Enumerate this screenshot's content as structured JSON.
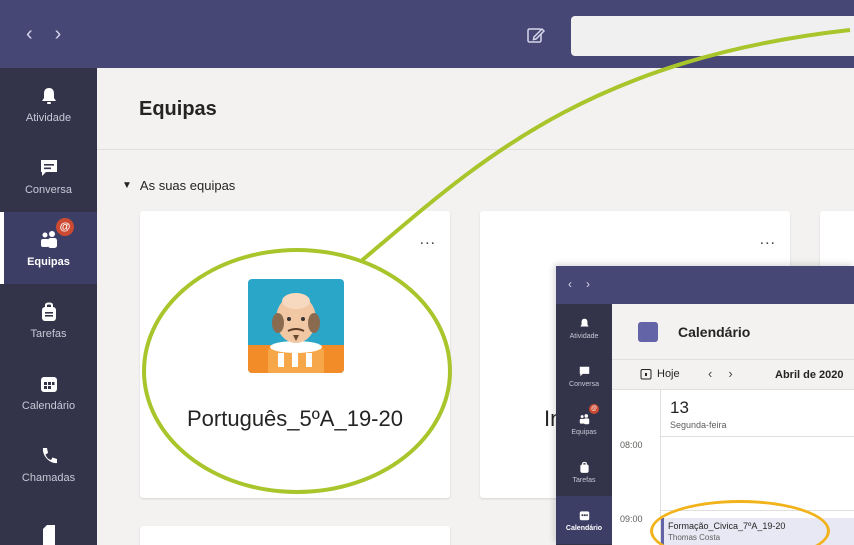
{
  "topbar": {
    "nav_back": "‹",
    "nav_forward": "›"
  },
  "rail": {
    "items": [
      {
        "label": "Atividade",
        "icon": "bell-icon"
      },
      {
        "label": "Conversa",
        "icon": "chat-icon"
      },
      {
        "label": "Equipas",
        "icon": "teams-icon",
        "badge": "@"
      },
      {
        "label": "Tarefas",
        "icon": "tasks-icon"
      },
      {
        "label": "Calendário",
        "icon": "calendar-icon"
      },
      {
        "label": "Chamadas",
        "icon": "phone-icon"
      }
    ]
  },
  "main": {
    "title": "Equipas",
    "section_label": "As suas equipas",
    "teams": [
      {
        "name": "Português_5ºA_19-20",
        "more": "..."
      },
      {
        "name": "In",
        "more": "..."
      }
    ]
  },
  "inset": {
    "rail": [
      {
        "label": "Atividade"
      },
      {
        "label": "Conversa"
      },
      {
        "label": "Equipas",
        "badge": "@"
      },
      {
        "label": "Tarefas"
      },
      {
        "label": "Calendário"
      }
    ],
    "title": "Calendário",
    "today_label": "Hoje",
    "month_label": "Abril de 2020",
    "day_number": "13",
    "day_name": "Segunda-feira",
    "times": [
      "08:00",
      "09:00"
    ],
    "event": {
      "title": "Formação_Civica_7ºA_19-20",
      "organizer": "Thomas Costa"
    }
  },
  "colors": {
    "topbar": "#464775",
    "rail": "#33344a",
    "accent": "#6264a7",
    "annotation_green": "#a9c52c",
    "annotation_orange": "#f2b31a"
  }
}
